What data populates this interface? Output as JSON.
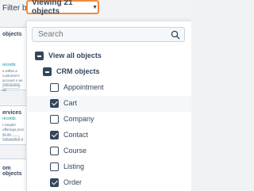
{
  "filter": {
    "label": "Filter by:",
    "button_label": "Viewing 21 objects"
  },
  "search": {
    "placeholder": "Search"
  },
  "view_all": {
    "label": "View all objects",
    "state": "indeterminate"
  },
  "group": {
    "label": "CRM objects",
    "state": "indeterminate"
  },
  "objects": [
    {
      "label": "Appointment",
      "checked": false
    },
    {
      "label": "Cart",
      "checked": true
    },
    {
      "label": "Company",
      "checked": false
    },
    {
      "label": "Contact",
      "checked": true
    },
    {
      "label": "Course",
      "checked": false
    },
    {
      "label": "Listing",
      "checked": false
    },
    {
      "label": "Order",
      "checked": true
    }
  ],
  "background": {
    "card1_header": "objects",
    "card2_header": "ervices",
    "card3_header": "om objects",
    "card2_text": "s within a customer's account s an onboarding as",
    "card3_text": "t simpler offerings proc as an onboarding p",
    "bottom_text": "Theme parks"
  },
  "colors": {
    "accent": "#f08a3e",
    "checkbox": "#33475b",
    "text": "#33475b"
  }
}
